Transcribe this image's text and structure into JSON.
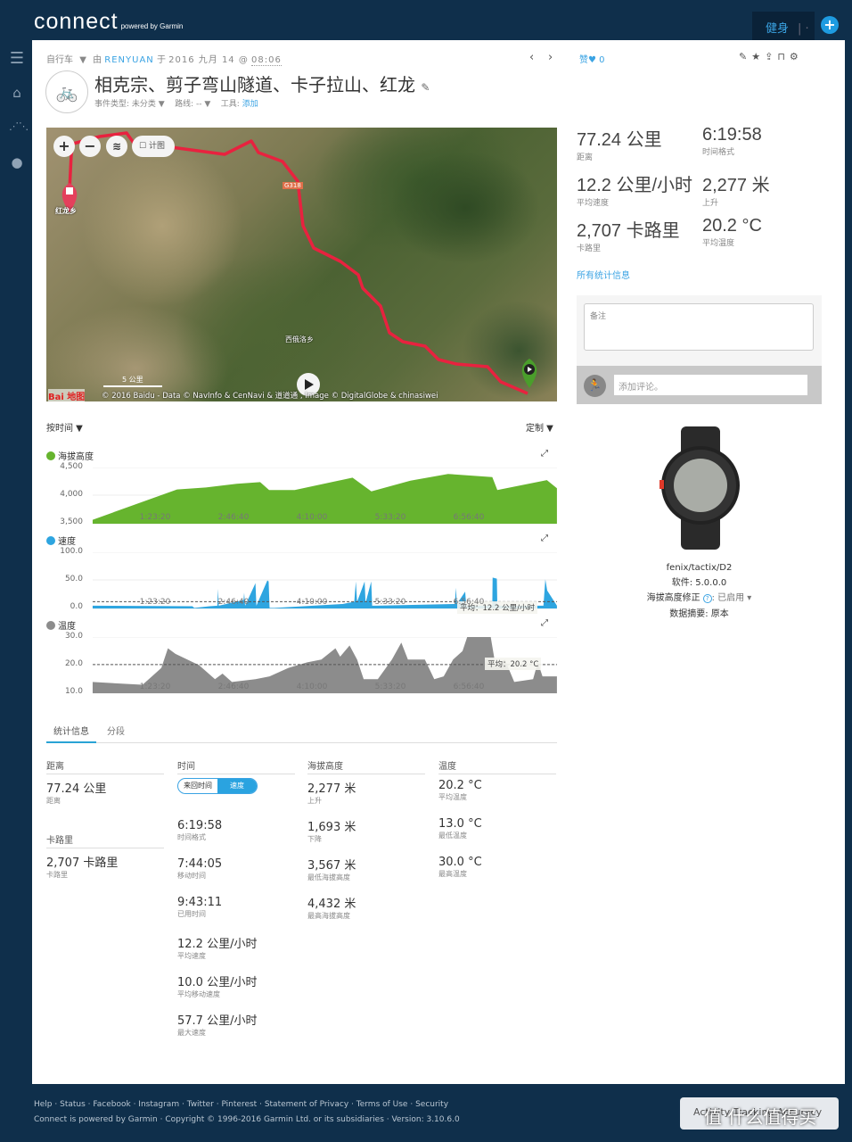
{
  "header": {
    "logo": "connect",
    "logo_sub": "powered by Garmin",
    "fitness": "健身",
    "plus": "+"
  },
  "sidebar": {
    "icons": [
      "menu-icon",
      "inbox-icon",
      "connections-icon",
      "user-icon"
    ]
  },
  "activity": {
    "type": "自行车",
    "by": "由",
    "user": "RENYUAN",
    "on": "于",
    "date": "2016 九月 14 @",
    "time": "08:06",
    "title": "相克宗、剪子弯山隧道、卡子拉山、红龙",
    "event_type": "事件类型: 未分类 ▼",
    "course": "路线: -- ▼",
    "gear_label": "工具:",
    "gear_add": "添加",
    "like": "赞",
    "like_count": "0"
  },
  "summary": [
    {
      "value": "77.24 公里",
      "label": "距离"
    },
    {
      "value": "6:19:58",
      "label": "时间格式"
    },
    {
      "value": "12.2 公里/小时",
      "label": "平均速度"
    },
    {
      "value": "2,277 米",
      "label": "上升"
    },
    {
      "value": "2,707 卡路里",
      "label": "卡路里"
    },
    {
      "value": "20.2 °C",
      "label": "平均温度"
    }
  ],
  "all_stats_link": "所有统计信息",
  "notes_placeholder": "备注",
  "comment_placeholder": "添加评论。",
  "device": {
    "name": "fenix/tactix/D2",
    "software": "软件: 5.0.0.0",
    "elev_corr": "海拔高度修正",
    "elev_corr_value": ": 已启用",
    "elev_corr_help": "?",
    "summary": "数据摘要: 原本"
  },
  "map": {
    "zoom_in": "+",
    "zoom_out": "−",
    "legend": "计图",
    "scale": "5 公里",
    "copyright": "© 2016 Baidu - Data © NavInfo & CenNavi & 道道通 , Image © DigitalGlobe & chinasiwei",
    "place1": "红龙乡",
    "place2": "西俄洛乡",
    "road": "G318",
    "baidu": "Bai  地图"
  },
  "chart_controls": {
    "by_time": "按时间 ▼",
    "customize": "定制 ▼"
  },
  "chart_data": [
    {
      "type": "area",
      "title": "海拔高度",
      "color": "#66b42e",
      "ylim": [
        3500,
        4500
      ],
      "yticks": [
        "4,500",
        "4,000",
        "3,500"
      ],
      "xticks": [
        "1:23:20",
        "2:46:40",
        "4:10:00",
        "5:33:20",
        "6:56:40"
      ],
      "points": [
        [
          "0:17:00",
          3570
        ],
        [
          "1:46:40",
          4110
        ],
        [
          "2:17:20",
          4145
        ],
        [
          "2:50:00",
          4210
        ],
        [
          "3:15:00",
          4240
        ],
        [
          "3:24:30",
          4100
        ],
        [
          "3:51:40",
          4100
        ],
        [
          "4:53:10",
          4320
        ],
        [
          "5:13:10",
          4075
        ],
        [
          "5:54:40",
          4265
        ],
        [
          "6:34:40",
          4385
        ],
        [
          "7:21:40",
          4330
        ],
        [
          "7:27:00",
          4100
        ],
        [
          "8:19:40",
          4275
        ],
        [
          "8:30:20",
          4130
        ]
      ]
    },
    {
      "type": "area",
      "title": "速度",
      "color": "#2ea5e0",
      "ylim": [
        0,
        100
      ],
      "yticks": [
        "100.0",
        "50.0",
        "0.0"
      ],
      "xticks": [
        "1:23:20",
        "2:46:40",
        "4:10:00",
        "5:33:20",
        "6:56:40"
      ],
      "average": 12.2,
      "average_label": "平均：12.2 公里/小时",
      "points": [
        [
          "0:17:00",
          5
        ],
        [
          "2:03:00",
          4
        ],
        [
          "2:05:00",
          1
        ],
        [
          "2:21:10",
          4
        ],
        [
          "2:29:30",
          5
        ],
        [
          "2:30:10",
          35
        ],
        [
          "2:31:00",
          5
        ],
        [
          "2:57:20",
          15
        ],
        [
          "2:58:00",
          28
        ],
        [
          "2:59:00",
          5
        ],
        [
          "3:10:00",
          45
        ],
        [
          "3:11:00",
          5
        ],
        [
          "3:22:40",
          50
        ],
        [
          "3:24:00",
          48
        ],
        [
          "3:25:00",
          1
        ],
        [
          "3:30:00",
          1
        ],
        [
          "4:42:30",
          8
        ],
        [
          "4:55:00",
          12
        ],
        [
          "4:56:40",
          48
        ],
        [
          "4:58:00",
          12
        ],
        [
          "5:06:00",
          48
        ],
        [
          "5:07:00",
          10
        ],
        [
          "5:13:00",
          48
        ],
        [
          "5:14:00",
          5
        ],
        [
          "5:18:40",
          5
        ],
        [
          "6:41:50",
          8
        ],
        [
          "6:43:00",
          37
        ],
        [
          "6:44:00",
          8
        ],
        [
          "6:52:50",
          30
        ],
        [
          "6:54:00",
          5
        ],
        [
          "7:21:40",
          5
        ],
        [
          "7:22:00",
          55
        ],
        [
          "7:26:30",
          53
        ],
        [
          "7:27:00",
          5
        ],
        [
          "8:16:00",
          5
        ],
        [
          "8:18:00",
          52
        ],
        [
          "8:20:00",
          32
        ],
        [
          "8:30:20",
          5
        ]
      ]
    },
    {
      "type": "area",
      "title": "温度",
      "color": "#8c8c8c",
      "ylim": [
        10,
        30
      ],
      "yticks": [
        "30.0",
        "20.0",
        "10.0"
      ],
      "xticks": [
        "1:23:20",
        "2:46:40",
        "4:10:00",
        "5:33:20",
        "6:56:40"
      ],
      "average": 20.2,
      "average_label": "平均：20.2 °C",
      "points": [
        [
          "0:17:00",
          14
        ],
        [
          "1:10:00",
          13
        ],
        [
          "1:20:00",
          16
        ],
        [
          "1:30:00",
          19
        ],
        [
          "1:37:00",
          26
        ],
        [
          "1:45:00",
          24
        ],
        [
          "2:10:00",
          20
        ],
        [
          "2:27:00",
          15
        ],
        [
          "2:35:00",
          17
        ],
        [
          "2:45:00",
          14
        ],
        [
          "3:10:00",
          15
        ],
        [
          "3:25:00",
          16
        ],
        [
          "3:45:00",
          19
        ],
        [
          "4:05:00",
          21
        ],
        [
          "4:20:00",
          22
        ],
        [
          "4:35:00",
          26
        ],
        [
          "4:40:00",
          23
        ],
        [
          "4:50:00",
          27
        ],
        [
          "4:58:00",
          22
        ],
        [
          "5:05:00",
          15
        ],
        [
          "5:20:00",
          15
        ],
        [
          "5:35:00",
          22
        ],
        [
          "5:45:00",
          28
        ],
        [
          "5:52:00",
          22
        ],
        [
          "6:10:00",
          22
        ],
        [
          "6:20:00",
          15
        ],
        [
          "6:30:00",
          16
        ],
        [
          "6:40:00",
          22
        ],
        [
          "6:50:00",
          25
        ],
        [
          "6:55:00",
          30
        ],
        [
          "7:20:00",
          30
        ],
        [
          "7:25:00",
          20
        ],
        [
          "7:35:00",
          22
        ],
        [
          "7:45:00",
          14
        ],
        [
          "8:05:00",
          15
        ],
        [
          "8:10:00",
          21
        ],
        [
          "8:15:00",
          16
        ],
        [
          "8:30:20",
          16
        ]
      ]
    }
  ],
  "tabs": [
    "统计信息",
    "分段"
  ],
  "stats": {
    "distance": {
      "header": "距离",
      "items": [
        {
          "value": "77.24 公里",
          "label": "距离"
        }
      ]
    },
    "calories": {
      "header": "卡路里",
      "items": [
        {
          "value": "2,707 卡路里",
          "label": "卡路里"
        }
      ]
    },
    "time": {
      "header": "时间",
      "toggle": [
        "来回时间",
        "速度"
      ],
      "items": [
        {
          "value": "6:19:58",
          "label": "时间格式"
        },
        {
          "value": "7:44:05",
          "label": "移动时间"
        },
        {
          "value": "9:43:11",
          "label": "已用时间"
        },
        {
          "value": "12.2 公里/小时",
          "label": "平均速度"
        },
        {
          "value": "10.0 公里/小时",
          "label": "平均移动速度"
        },
        {
          "value": "57.7 公里/小时",
          "label": "最大速度"
        }
      ]
    },
    "elevation": {
      "header": "海拔高度",
      "items": [
        {
          "value": "2,277 米",
          "label": "上升"
        },
        {
          "value": "1,693 米",
          "label": "下降"
        },
        {
          "value": "3,567 米",
          "label": "最低海拔高度"
        },
        {
          "value": "4,432 米",
          "label": "最高海拔高度"
        }
      ]
    },
    "temperature": {
      "header": "温度",
      "items": [
        {
          "value": "20.2 °C",
          "label": "平均温度"
        },
        {
          "value": "13.0 °C",
          "label": "最低温度"
        },
        {
          "value": "30.0 °C",
          "label": "最高温度"
        }
      ]
    }
  },
  "footer": {
    "links": [
      "Help",
      "Status",
      "Facebook",
      "Instagram",
      "Twitter",
      "Pinterest",
      "Statement of Privacy",
      "Terms of Use",
      "Security"
    ],
    "copyright": "Connect is powered by Garmin · Copyright © 1996-2016 Garmin Ltd. or its subsidiaries · Version: 3.10.6.0",
    "access_button": "Activity Tracking Accuracy",
    "watermark": "值 什么值得买"
  }
}
